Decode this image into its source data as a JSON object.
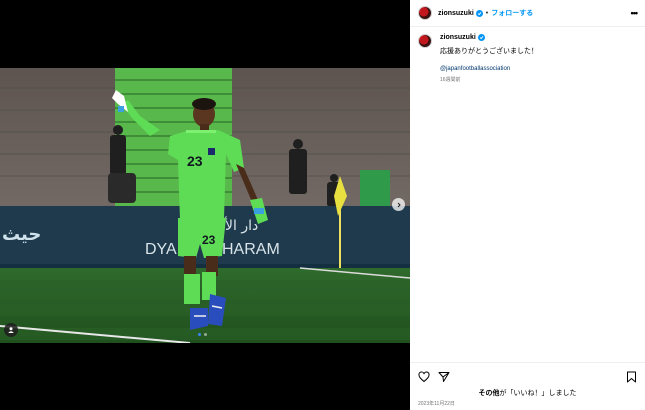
{
  "header": {
    "username": "zionsuzuki",
    "separator": "•",
    "follow_label": "フォローする",
    "more_label": "•••"
  },
  "caption": {
    "username": "zionsuzuki",
    "text": "応援ありがとうございました！",
    "mention": "@japanfootballassociation",
    "time_ago": "16週間前"
  },
  "photo": {
    "player_number": "23",
    "board_left_text": "حيث",
    "board_text_1": "DYA",
    "board_text_2": "HARAM",
    "board_arabic": "دار الأ"
  },
  "footer": {
    "likes_prefix": "その他",
    "likes_middle": "が「いいね！」しました",
    "date": "2023年11月22日"
  },
  "carousel": {
    "current": 1,
    "total": 2
  },
  "colors": {
    "accent": "#0095f6",
    "kit": "#5fdc55"
  }
}
